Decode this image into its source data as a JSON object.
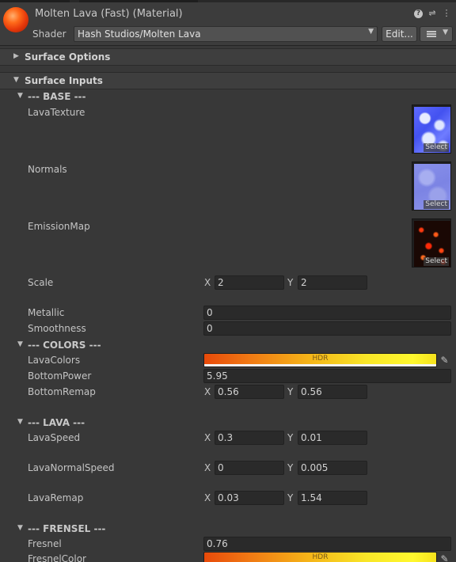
{
  "header": {
    "title": "Molten Lava (Fast) (Material)",
    "shader_label": "Shader",
    "shader_value": "Hash Studios/Molten Lava",
    "edit_label": "Edit...",
    "icons": [
      "help-icon",
      "preset-icon",
      "kebab-icon"
    ]
  },
  "sections": {
    "surface_options": "Surface Options",
    "surface_inputs": "Surface Inputs"
  },
  "base": {
    "title": "--- BASE ---",
    "lava_texture": "LavaTexture",
    "normals": "Normals",
    "emission_map": "EmissionMap",
    "select": "Select",
    "scale_label": "Scale",
    "scale_x": "2",
    "scale_y": "2",
    "metallic_label": "Metallic",
    "metallic": "0",
    "smoothness_label": "Smoothness",
    "smoothness": "0"
  },
  "colors": {
    "title": "--- COLORS ---",
    "lava_colors_label": "LavaColors",
    "hdr": "HDR",
    "bottom_power_label": "BottomPower",
    "bottom_power": "5.95",
    "bottom_remap_label": "BottomRemap",
    "bottom_remap_x": "0.56",
    "bottom_remap_y": "0.56"
  },
  "lava": {
    "title": "--- LAVA ---",
    "speed_label": "LavaSpeed",
    "speed_x": "0.3",
    "speed_y": "0.01",
    "normal_speed_label": "LavaNormalSpeed",
    "normal_speed_x": "0",
    "normal_speed_y": "0.005",
    "remap_label": "LavaRemap",
    "remap_x": "0.03",
    "remap_y": "1.54"
  },
  "fresnel": {
    "title": "--- FRENSEL ---",
    "fresnel_label": "Fresnel",
    "fresnel": "0.76",
    "color_label": "FresnelColor",
    "hdr": "HDR"
  },
  "axis": {
    "x": "X",
    "y": "Y"
  },
  "colors_theme": {
    "panel": "#383838",
    "field": "#2a2a2a",
    "accent": "#f5b418"
  }
}
